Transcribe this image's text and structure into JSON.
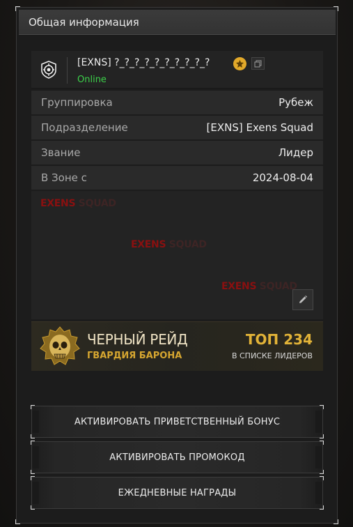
{
  "panel": {
    "title": "Общая информация"
  },
  "user": {
    "name": "[EXNS] ?_?_?_?_?_?_?_?_?_?",
    "status": "Online",
    "status_color": "#3cd04a",
    "clan_icon": "clan-emblem-icon",
    "badge_icon": "gold-badge-icon",
    "copy_icon": "copy-icon"
  },
  "details": [
    {
      "label": "Группировка",
      "value": "Рубеж"
    },
    {
      "label": "Подразделение",
      "value": "[EXNS] Exens Squad"
    },
    {
      "label": "Звание",
      "value": "Лидер"
    },
    {
      "label": "В Зоне с",
      "value": "2024-08-04"
    }
  ],
  "banner": {
    "watermarks": [
      {
        "a": "EXENS",
        "b": " SQUAD"
      },
      {
        "a": "EXENS",
        "b": " SQUAD"
      },
      {
        "a": "EXENS",
        "b": " SQUAD"
      }
    ],
    "edit_icon": "pencil-icon"
  },
  "raid": {
    "title": "ЧЕРНЫЙ РЕЙД",
    "subtitle": "ГВАРДИЯ БАРОНА",
    "rank": "ТОП 234",
    "rank_sub": "В СПИСКЕ ЛИДЕРОВ",
    "accent": "#e2b338"
  },
  "actions": [
    {
      "label": "АКТИВИРОВАТЬ ПРИВЕТСТВЕННЫЙ БОНУС"
    },
    {
      "label": "АКТИВИРОВАТЬ ПРОМОКОД"
    },
    {
      "label": "ЕЖЕДНЕВНЫЕ НАГРАДЫ"
    }
  ]
}
